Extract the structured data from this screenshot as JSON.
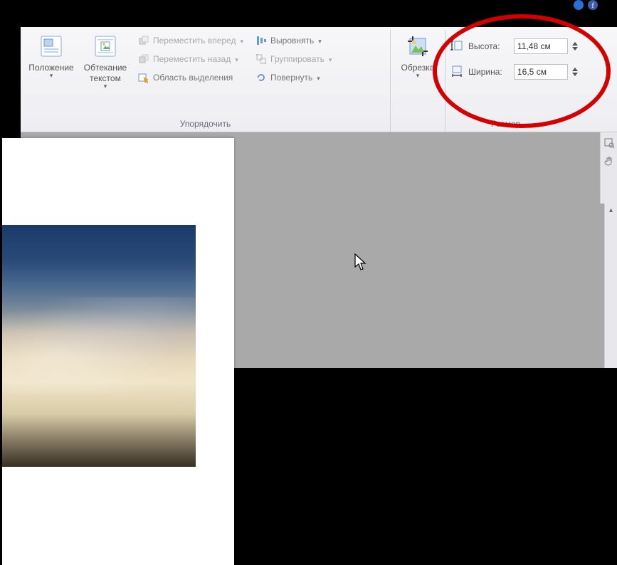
{
  "ribbon": {
    "groups": {
      "arrange": {
        "label": "Упорядочить",
        "position": "Положение",
        "wrap": "Обтекание текстом",
        "bring_forward": "Переместить вперед",
        "send_backward": "Переместить назад",
        "selection_pane": "Область выделения",
        "align": "Выровнять",
        "group": "Группировать",
        "rotate": "Повернуть"
      },
      "crop": {
        "crop": "Обрезка"
      },
      "size": {
        "label": "Размер",
        "height_label": "Высота:",
        "height_value": "11,48 см",
        "width_label": "Ширина:",
        "width_value": "16,5 см"
      }
    }
  }
}
